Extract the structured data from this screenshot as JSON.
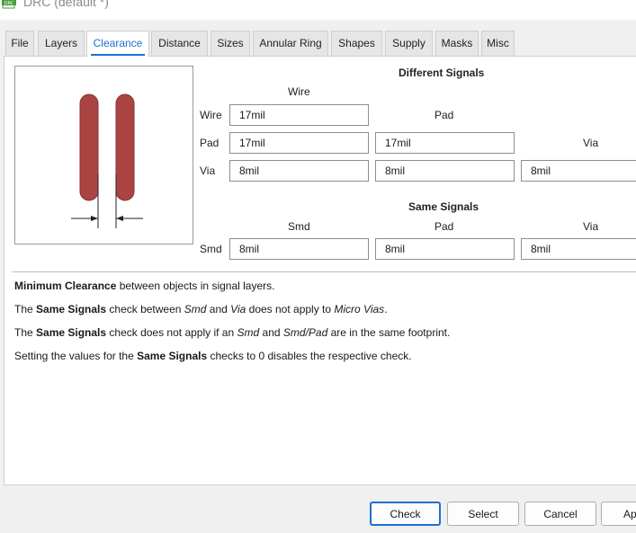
{
  "window": {
    "title": "DRC (default *)",
    "icon": "drc-app-icon",
    "icon_text": "DRC"
  },
  "tabs": [
    {
      "label": "File"
    },
    {
      "label": "Layers"
    },
    {
      "label": "Clearance",
      "active": true
    },
    {
      "label": "Distance"
    },
    {
      "label": "Sizes"
    },
    {
      "label": "Annular Ring"
    },
    {
      "label": "Shapes"
    },
    {
      "label": "Supply"
    },
    {
      "label": "Masks"
    },
    {
      "label": "Misc"
    }
  ],
  "different_signals": {
    "title": "Different Signals",
    "col_headers": {
      "wire": "Wire",
      "pad": "Pad",
      "via": "Via"
    },
    "row_labels": {
      "wire": "Wire",
      "pad": "Pad",
      "via": "Via"
    },
    "values": {
      "wire_wire": "17mil",
      "pad_wire": "17mil",
      "pad_pad": "17mil",
      "via_wire": "8mil",
      "via_pad": "8mil",
      "via_via": "8mil"
    }
  },
  "same_signals": {
    "title": "Same Signals",
    "col_headers": {
      "smd": "Smd",
      "pad": "Pad",
      "via": "Via"
    },
    "row_label": "Smd",
    "values": {
      "smd_smd": "8mil",
      "smd_pad": "8mil",
      "smd_via": "8mil"
    }
  },
  "info": {
    "line1": {
      "b1": "Minimum Clearance",
      "t1": " between objects in signal layers."
    },
    "line2": {
      "t0": "The ",
      "b1": "Same Signals",
      "t1": " check between ",
      "i1": "Smd",
      "t2": " and ",
      "i2": "Via",
      "t3": " does not apply to ",
      "i3": "Micro Vias",
      "t4": "."
    },
    "line3": {
      "t0": "The ",
      "b1": "Same Signals",
      "t1": " check does not apply if an ",
      "i1": "Smd",
      "t2": " and ",
      "i2": "Smd/Pad",
      "t3": " are in the same footprint."
    },
    "line4": {
      "t0": "Setting the values for the ",
      "b1": "Same Signals",
      "t1": " checks to 0 disables the respective check."
    }
  },
  "buttons": {
    "check": "Check",
    "select": "Select",
    "cancel": "Cancel",
    "apply": "Apply"
  },
  "colors": {
    "accent": "#1d6fd0",
    "trace": "#a94442",
    "icon_green": "#4a9a3c"
  }
}
